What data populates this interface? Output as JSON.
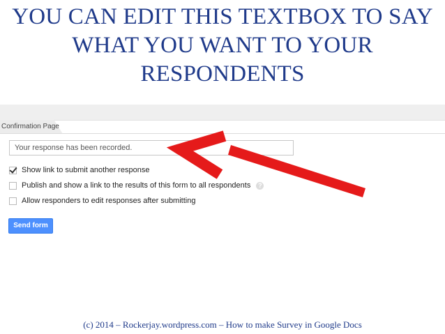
{
  "slide": {
    "title": "YOU CAN EDIT THIS TEXTBOX TO SAY WHAT YOU WANT TO YOUR RESPONDENTS",
    "footer": "(c) 2014 – Rockerjay.wordpress.com – How to make Survey in Google Docs"
  },
  "confirmation_page": {
    "section_label": "Confirmation Page",
    "message_value": "Your response has been recorded.",
    "options": [
      {
        "label": "Show link to submit another response",
        "checked": true
      },
      {
        "label": "Publish and show a link to the results of this form to all respondents",
        "checked": false,
        "help_icon": "?"
      },
      {
        "label": "Allow responders to edit responses after submitting",
        "checked": false
      }
    ],
    "send_button_label": "Send form"
  },
  "colors": {
    "title": "#1f3a8a",
    "arrow": "#e51a1a",
    "button": "#4d90fe"
  },
  "icons": [
    "check-icon",
    "help-icon",
    "red-arrow-annotation"
  ]
}
